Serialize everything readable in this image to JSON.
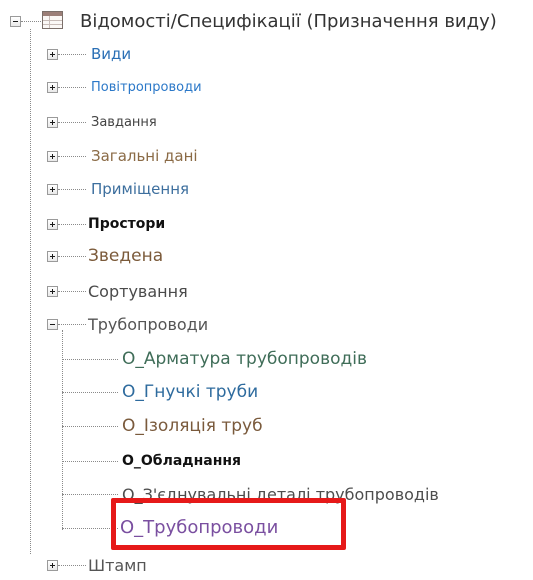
{
  "tree": {
    "root": {
      "label": "Відомості/Специфікації (Призначення виду)",
      "expanded": true,
      "icon": "schedule-table-icon"
    },
    "groups": [
      {
        "label": "Види",
        "color": "#2a6fb5",
        "expanded": false
      },
      {
        "label": "Повітропроводи",
        "color": "#2b78c8",
        "expanded": false
      },
      {
        "label": "Завдання",
        "color": "#444444",
        "expanded": false
      },
      {
        "label": "Загальні дані",
        "color": "#8a6a45",
        "expanded": false
      },
      {
        "label": "Приміщення",
        "color": "#3d6f9e",
        "expanded": false
      },
      {
        "label": "Простори",
        "color": "#111111",
        "expanded": false
      },
      {
        "label": "Зведена",
        "color": "#7b5a3a",
        "expanded": false
      },
      {
        "label": "Сортування",
        "color": "#4a4a4a",
        "expanded": false
      },
      {
        "label": "Трубопроводи",
        "color": "#555555",
        "expanded": true
      }
    ],
    "pipe_children": [
      {
        "label": "О_Арматура трубопроводів",
        "color": "#3f6d58"
      },
      {
        "label": "О_Гнучкі труби",
        "color": "#2e6b9e"
      },
      {
        "label": "О_Ізоляція труб",
        "color": "#7a5a3c"
      },
      {
        "label": "О_Обладнання",
        "color": "#111111"
      },
      {
        "label": "О_З'єднувальні деталі трубопроводів",
        "color": "#4d4d4d"
      },
      {
        "label": "О_Трубопроводи",
        "color": "#7a4fa0",
        "highlighted": true
      }
    ],
    "last_group": {
      "label": "Штамп",
      "color": "#555555",
      "expanded": false
    }
  },
  "highlight_color": "#e61919"
}
